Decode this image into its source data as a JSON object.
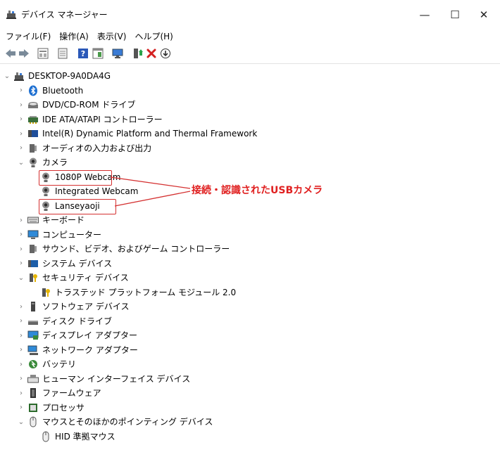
{
  "window": {
    "title": "デバイス マネージャー",
    "controls": {
      "minimize": "—",
      "maximize": "☐",
      "close": "✕"
    }
  },
  "menu": [
    "ファイル(F)",
    "操作(A)",
    "表示(V)",
    "ヘルプ(H)"
  ],
  "toolbar": [
    "back-arrow-icon",
    "forward-arrow-icon",
    "properties-grid-icon",
    "details-icon",
    "help-icon",
    "view-pane-icon",
    "monitor-scan-icon",
    "update-driver-icon",
    "uninstall-x-icon",
    "download-circle-icon"
  ],
  "tree": {
    "root": "DESKTOP-9A0DA4G",
    "items": [
      {
        "label": "Bluetooth",
        "icon": "bluetooth-icon",
        "state": "collapsed",
        "level": 1
      },
      {
        "label": "DVD/CD-ROM ドライブ",
        "icon": "dvd-drive-icon",
        "state": "collapsed",
        "level": 1
      },
      {
        "label": "IDE ATA/ATAPI コントローラー",
        "icon": "ide-controller-icon",
        "state": "collapsed",
        "level": 1
      },
      {
        "label": "Intel(R) Dynamic Platform and Thermal Framework",
        "icon": "intel-device-icon",
        "state": "collapsed",
        "level": 1
      },
      {
        "label": "オーディオの入力および出力",
        "icon": "speaker-icon",
        "state": "collapsed",
        "level": 1
      },
      {
        "label": "カメラ",
        "icon": "camera-icon",
        "state": "expanded",
        "level": 1
      },
      {
        "label": "1080P Webcam",
        "icon": "webcam-icon",
        "state": "leaf",
        "level": 2,
        "highlighted": true
      },
      {
        "label": "Integrated Webcam",
        "icon": "webcam-icon",
        "state": "leaf",
        "level": 2
      },
      {
        "label": "Lanseyaoji",
        "icon": "webcam-icon",
        "state": "leaf",
        "level": 2,
        "highlighted": true
      },
      {
        "label": "キーボード",
        "icon": "keyboard-icon",
        "state": "collapsed",
        "level": 1
      },
      {
        "label": "コンピューター",
        "icon": "computer-icon",
        "state": "collapsed",
        "level": 1
      },
      {
        "label": "サウンド、ビデオ、およびゲーム コントローラー",
        "icon": "speaker-icon",
        "state": "collapsed",
        "level": 1
      },
      {
        "label": "システム デバイス",
        "icon": "system-folder-icon",
        "state": "collapsed",
        "level": 1
      },
      {
        "label": "セキュリティ デバイス",
        "icon": "security-key-icon",
        "state": "expanded",
        "level": 1
      },
      {
        "label": "トラステッド プラットフォーム モジュール 2.0",
        "icon": "security-key-icon",
        "state": "leaf",
        "level": 2
      },
      {
        "label": "ソフトウェア デバイス",
        "icon": "software-device-icon",
        "state": "collapsed",
        "level": 1
      },
      {
        "label": "ディスク ドライブ",
        "icon": "disk-drive-icon",
        "state": "collapsed",
        "level": 1
      },
      {
        "label": "ディスプレイ アダプター",
        "icon": "display-adapter-icon",
        "state": "collapsed",
        "level": 1
      },
      {
        "label": "ネットワーク アダプター",
        "icon": "network-adapter-icon",
        "state": "collapsed",
        "level": 1
      },
      {
        "label": "バッテリ",
        "icon": "battery-icon",
        "state": "collapsed",
        "level": 1
      },
      {
        "label": "ヒューマン インターフェイス デバイス",
        "icon": "hid-icon",
        "state": "collapsed",
        "level": 1
      },
      {
        "label": "ファームウェア",
        "icon": "firmware-icon",
        "state": "collapsed",
        "level": 1
      },
      {
        "label": "プロセッサ",
        "icon": "processor-icon",
        "state": "collapsed",
        "level": 1
      },
      {
        "label": "マウスとそのほかのポインティング デバイス",
        "icon": "mouse-icon",
        "state": "expanded",
        "level": 1
      },
      {
        "label": "HID 準拠マウス",
        "icon": "mouse-icon",
        "state": "leaf",
        "level": 2
      }
    ]
  },
  "annotation": {
    "text": "接続・認識されたUSBカメラ",
    "color": "#e02020"
  },
  "colors": {
    "accent": "#0078d7",
    "highlight_border": "#d43030"
  }
}
